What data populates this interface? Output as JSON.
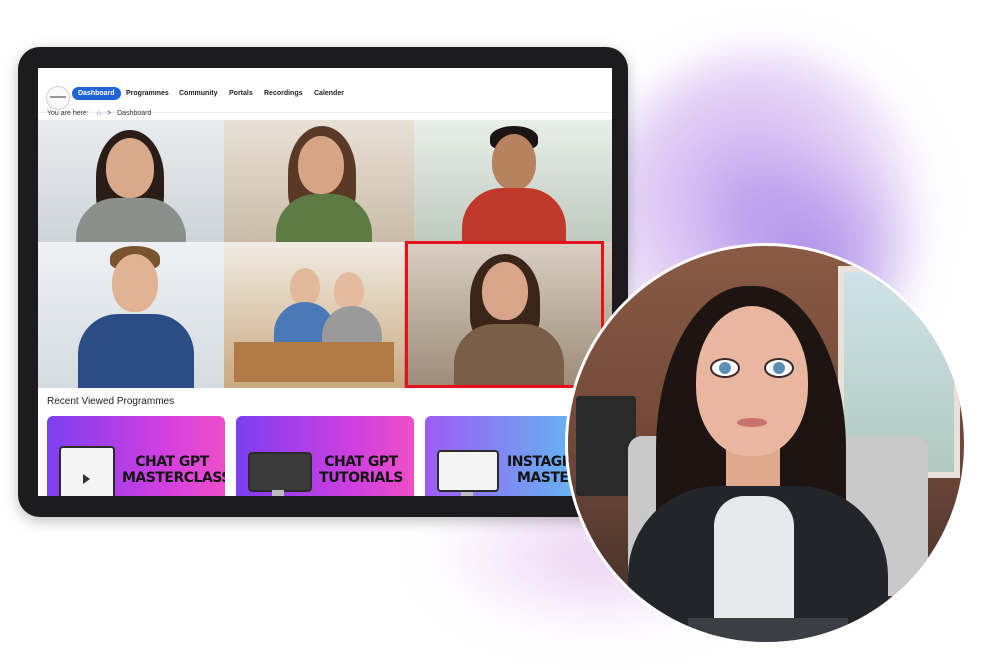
{
  "nav": {
    "logo_text": "",
    "items": [
      {
        "label": "Dashboard",
        "active": true
      },
      {
        "label": "Programmes",
        "active": false
      },
      {
        "label": "Community",
        "active": false
      },
      {
        "label": "Portals",
        "active": false
      },
      {
        "label": "Recordings",
        "active": false
      },
      {
        "label": "Calender",
        "active": false
      }
    ]
  },
  "breadcrumb": {
    "prefix": "You are here:",
    "home_icon": "home-icon",
    "separator": ">",
    "current": "Dashboard"
  },
  "video_grid": {
    "tile_count": 6,
    "highlighted_tile": 6,
    "highlight_color": "#e8101a"
  },
  "recent": {
    "title": "Recent Viewed Programmes",
    "cards": [
      {
        "title_line1": "CHAT GPT",
        "title_line2": "MASTERCLASS"
      },
      {
        "title_line1": "CHAT GPT",
        "title_line2": "TUTORIALS"
      },
      {
        "title_line1": "INSTAGRA",
        "title_line2": "MASTER"
      }
    ]
  },
  "colors": {
    "accent": "#1f63d6",
    "card_gradient_pink": "#d13fe0",
    "card_gradient_blue": "#5ec3ee",
    "splash": "#ba96eb"
  }
}
